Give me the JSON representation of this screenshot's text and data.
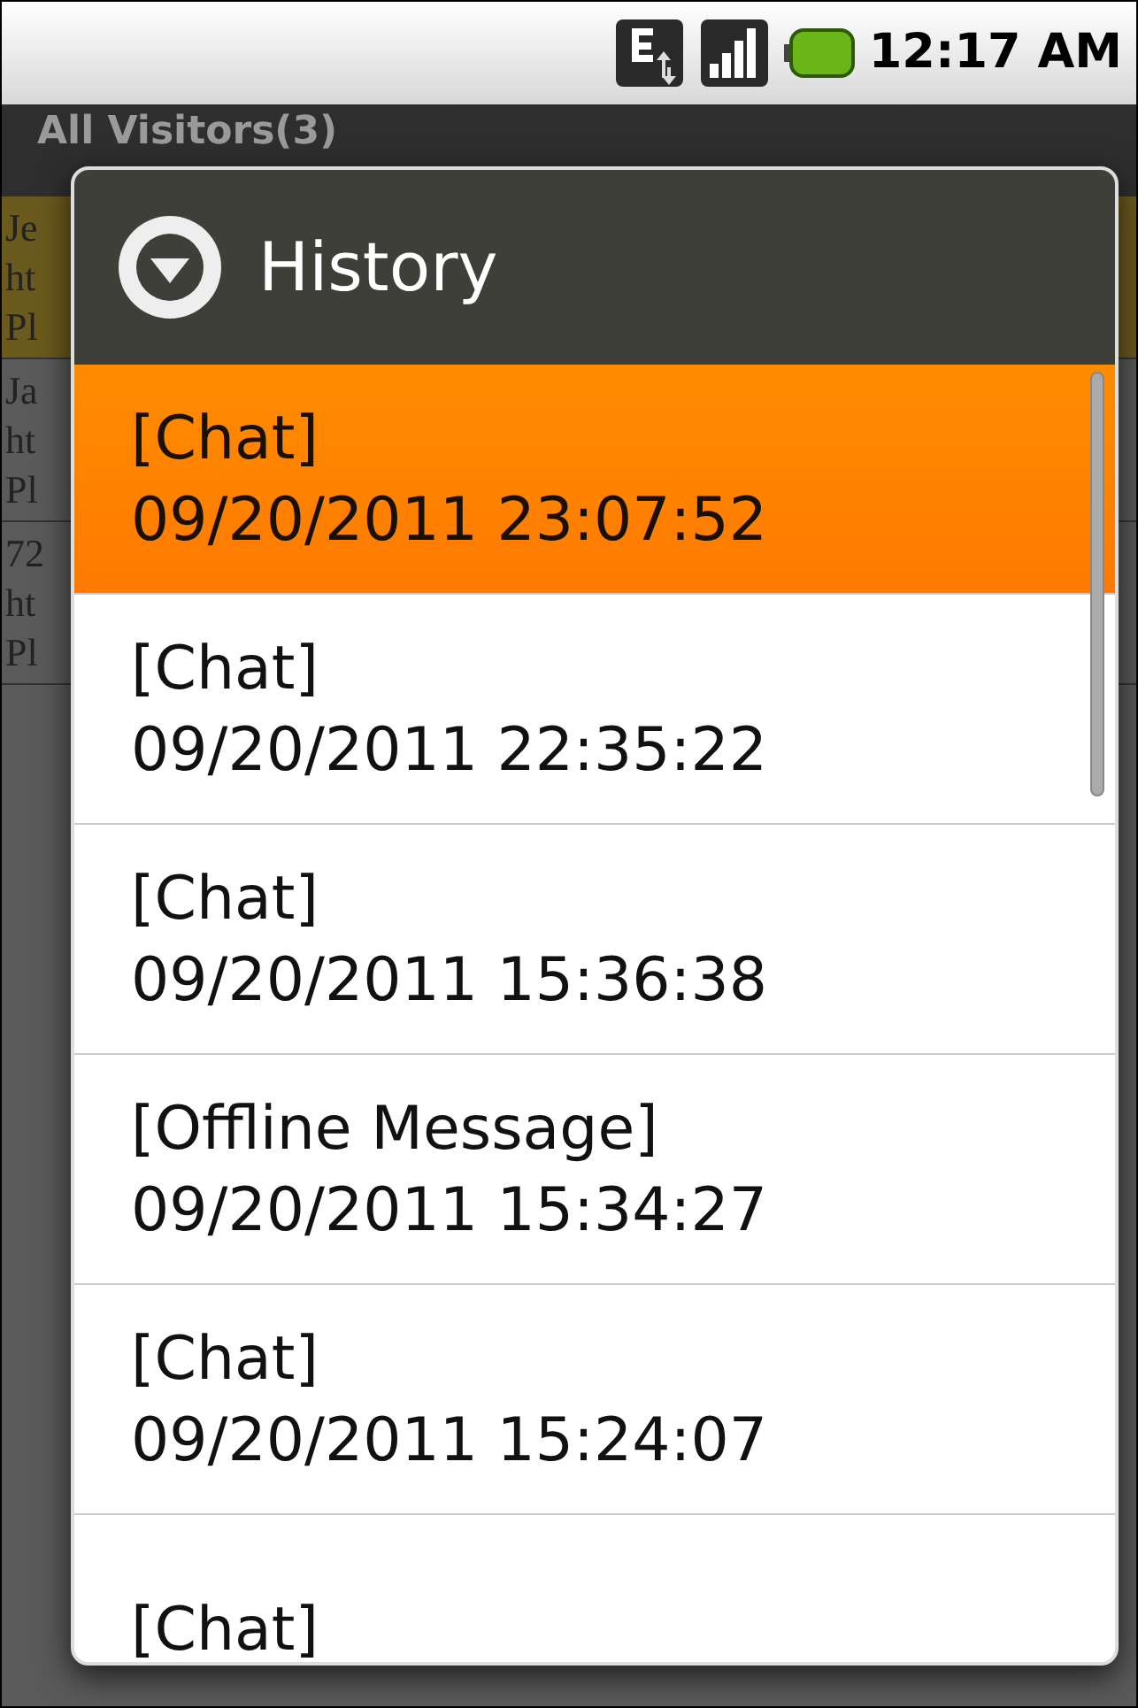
{
  "status_bar": {
    "time": "12:17 AM"
  },
  "background": {
    "title": "All Visitors(3)",
    "rows": [
      {
        "lines": [
          "Je",
          "ht",
          "Pl"
        ],
        "highlighted": true
      },
      {
        "lines": [
          "Ja",
          "ht",
          "Pl"
        ],
        "highlighted": false
      },
      {
        "lines": [
          "72",
          "ht",
          "Pl"
        ],
        "highlighted": false
      }
    ]
  },
  "dialog": {
    "title": "History",
    "items": [
      {
        "type": "[Chat]",
        "time": "09/20/2011 23:07:52",
        "selected": true
      },
      {
        "type": "[Chat]",
        "time": "09/20/2011 22:35:22",
        "selected": false
      },
      {
        "type": "[Chat]",
        "time": "09/20/2011 15:36:38",
        "selected": false
      },
      {
        "type": "[Offline Message]",
        "time": "09/20/2011 15:34:27",
        "selected": false
      },
      {
        "type": "[Chat]",
        "time": "09/20/2011 15:24:07",
        "selected": false
      },
      {
        "type": "[Chat]",
        "selected": false
      }
    ]
  }
}
